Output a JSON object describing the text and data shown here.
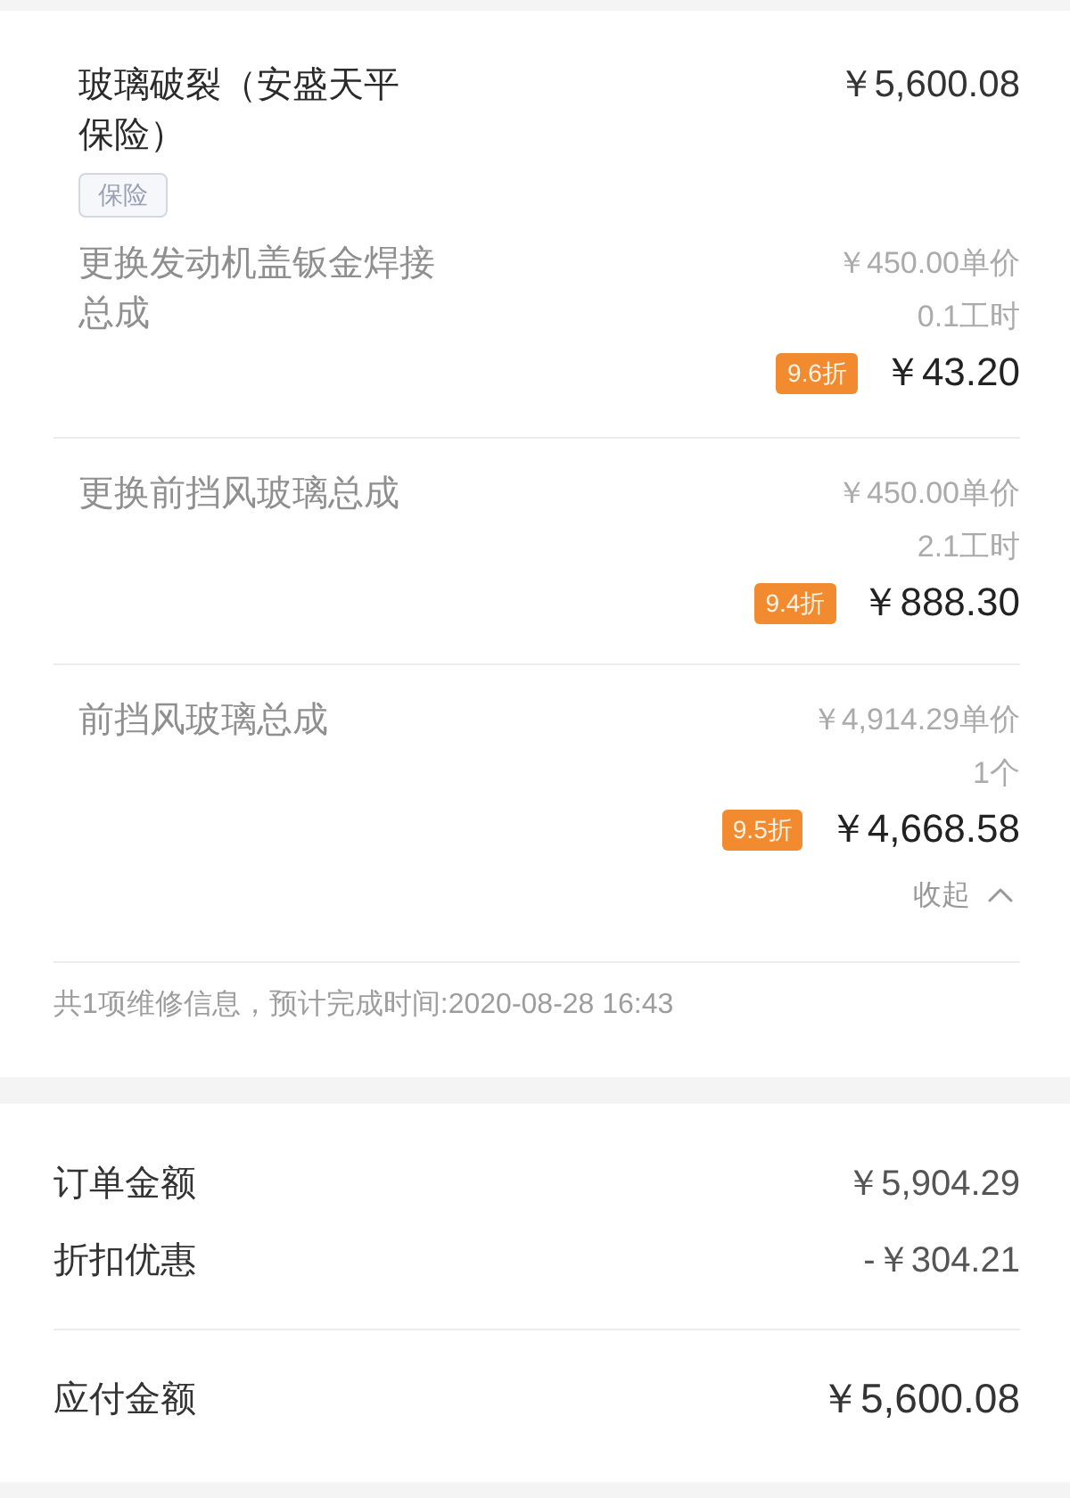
{
  "claim": {
    "title": "玻璃破裂（安盛天平保险）",
    "amount": "￥5,600.08",
    "tag": "保险",
    "expanded": true,
    "collapse_label": "收起",
    "items": [
      {
        "name": "更换发动机盖钣金焊接总成",
        "unit_price": "￥450.00单价",
        "quantity": "0.1工时",
        "discount": "9.6折",
        "price": "￥43.20"
      },
      {
        "name": "更换前挡风玻璃总成",
        "unit_price": "￥450.00单价",
        "quantity": "2.1工时",
        "discount": "9.4折",
        "price": "￥888.30"
      },
      {
        "name": "前挡风玻璃总成",
        "unit_price": "￥4,914.29单价",
        "quantity": "1个",
        "discount": "9.5折",
        "price": "￥4,668.58"
      }
    ]
  },
  "summary": "共1项维修信息，预计完成时间:2020-08-28 16:43",
  "totals": [
    {
      "label": "订单金额",
      "value": "￥5,904.29"
    },
    {
      "label": "折扣优惠",
      "value": "-￥304.21"
    }
  ],
  "payable": {
    "label": "应付金额",
    "value": "￥5,600.08"
  }
}
